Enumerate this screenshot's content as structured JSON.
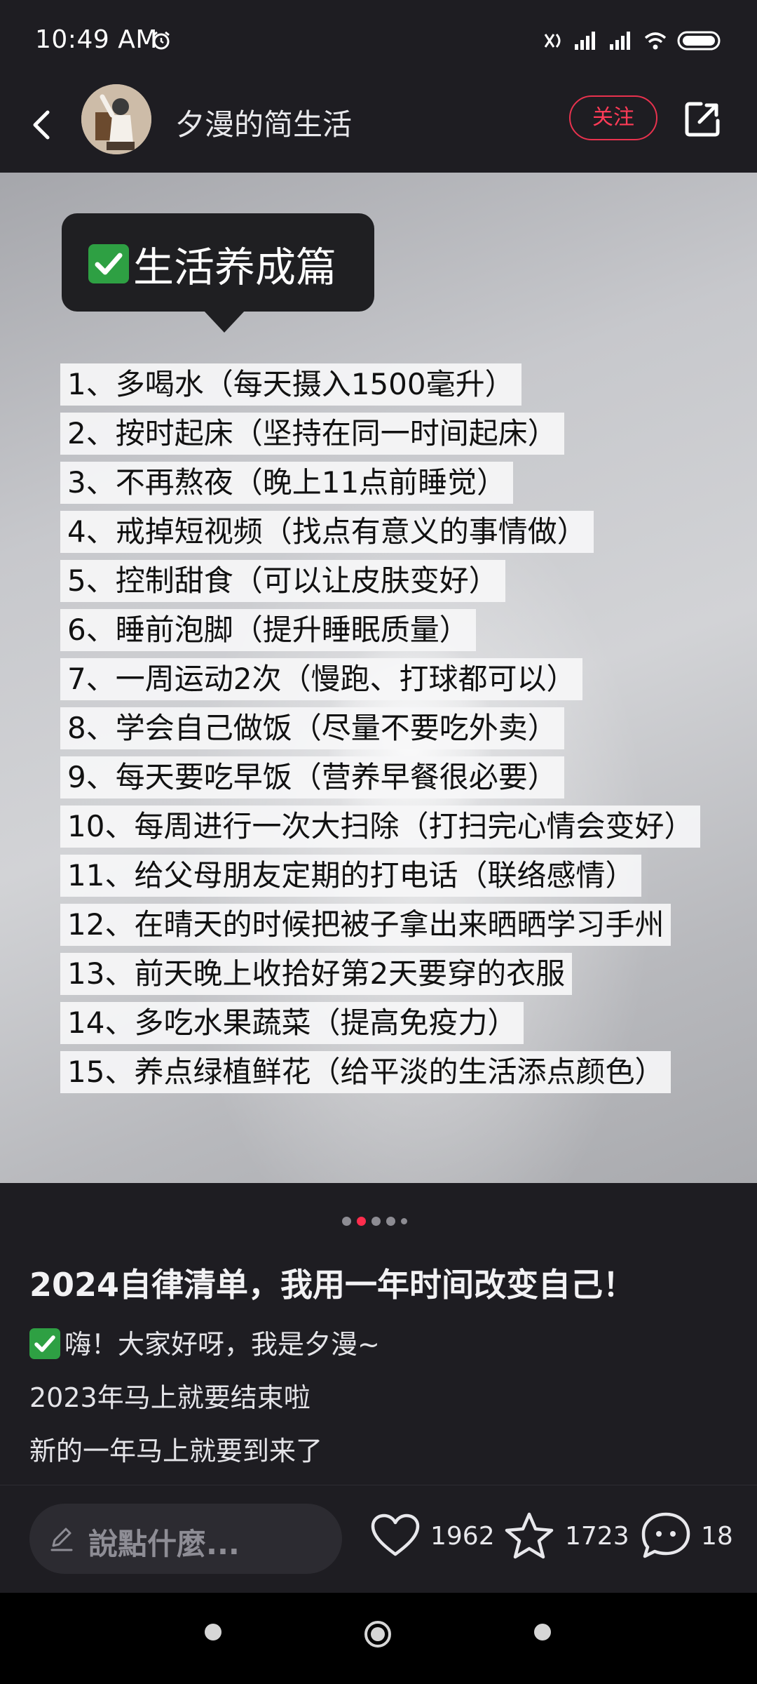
{
  "status_bar": {
    "time": "10:49 AM",
    "icons": [
      "alarm-icon",
      "mute-icon",
      "signal-icon",
      "signal-icon",
      "wifi-icon",
      "battery-icon"
    ]
  },
  "header": {
    "username": "夕漫的简生活",
    "follow_label": "关注",
    "icons": [
      "back-icon",
      "share-icon"
    ]
  },
  "image": {
    "section_title": "生活养成篇",
    "items": [
      "1、多喝水（每天摄入1500毫升）",
      "2、按时起床（坚持在同一时间起床）",
      "3、不再熬夜（晚上11点前睡觉）",
      "4、戒掉短视频（找点有意义的事情做）",
      "5、控制甜食（可以让皮肤变好）",
      "6、睡前泡脚（提升睡眠质量）",
      "7、一周运动2次（慢跑、打球都可以）",
      "8、学会自己做饭（尽量不要吃外卖）",
      "9、每天要吃早饭（营养早餐很必要）",
      "10、每周进行一次大扫除（打扫完心情会变好）",
      "11、给父母朋友定期的打电话（联络感情）",
      "12、在晴天的时候把被子拿出来晒晒学习手州",
      "13、前天晚上收拾好第2天要穿的衣服",
      "14、多吃水果蔬菜（提高免疫力）",
      "15、养点绿植鲜花（给平淡的生活添点颜色）"
    ]
  },
  "carousel": {
    "count": 5,
    "active_index": 1
  },
  "post": {
    "title": "2024自律清单，我用一年时间改变自己！",
    "lines": [
      "嗨！大家好呀，我是夕漫~",
      "2023年马上就要结束啦",
      "新的一年马上就要到来了"
    ]
  },
  "bottom_bar": {
    "comment_placeholder": "說點什麼...",
    "likes": "1962",
    "favorites": "1723",
    "comments": "18"
  },
  "colors": {
    "background": "#1e1d22",
    "accent": "#ff2d4d",
    "check_green": "#2ea043"
  }
}
